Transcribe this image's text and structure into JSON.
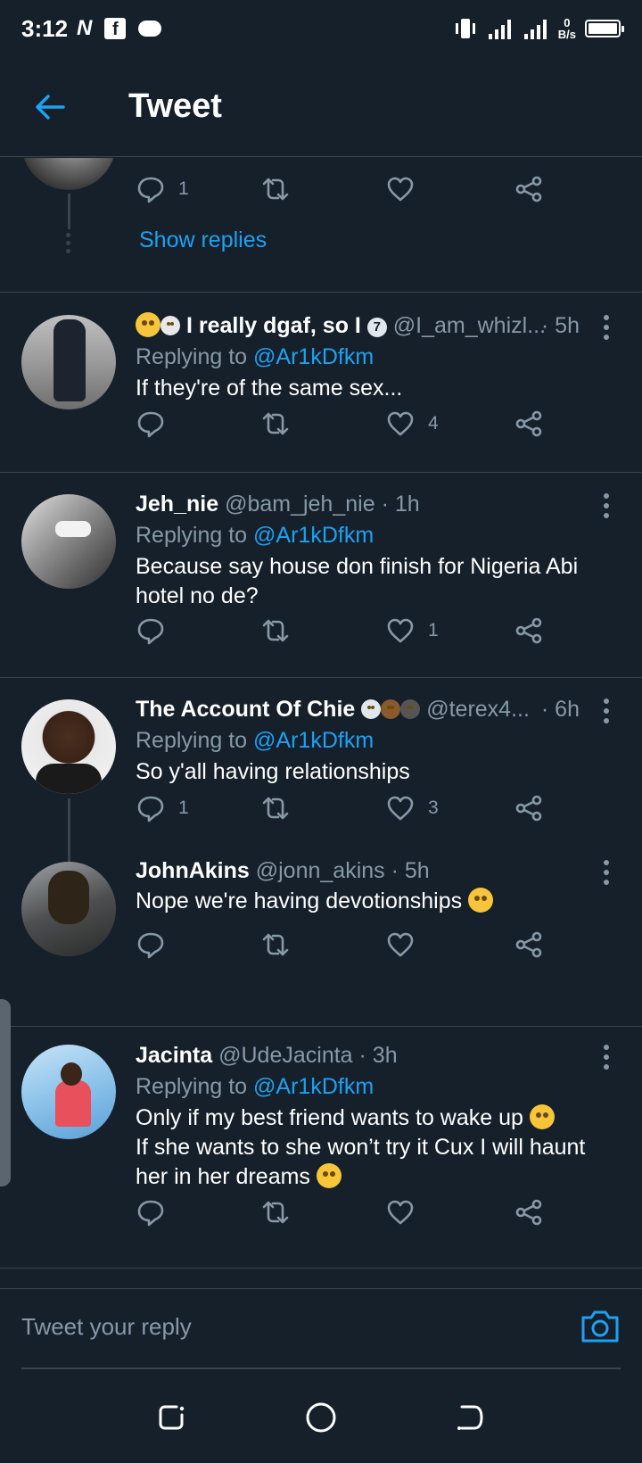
{
  "status_bar": {
    "time": "3:12",
    "left_icons": [
      "N",
      "f"
    ],
    "net_speed_value": "0",
    "net_speed_unit": "B/s"
  },
  "header": {
    "title": "Tweet"
  },
  "colors": {
    "background": "#15202b",
    "accent": "#1da1f2",
    "muted": "#8899a6",
    "divider": "#38444d"
  },
  "top_tweet": {
    "reply_count": "1",
    "show_replies": "Show replies"
  },
  "tweets": [
    {
      "name": "I really dgaf, so I",
      "handle": "@I_am_whizl...",
      "time": "· 5h",
      "replying_prefix": "Replying to ",
      "replying_to": "@Ar1kDfkm",
      "text": "If they're of the same sex...",
      "reply_count": "",
      "like_count": "4"
    },
    {
      "name": "Jeh_nie",
      "handle": "@bam_jeh_nie",
      "time": "· 1h",
      "replying_prefix": "Replying to ",
      "replying_to": "@Ar1kDfkm",
      "text": "Because say house don finish for Nigeria Abi hotel no de?",
      "reply_count": "",
      "like_count": "1"
    },
    {
      "name": "The Account Of Chie",
      "handle": "@terex4...",
      "time": "· 6h",
      "replying_prefix": "Replying to ",
      "replying_to": "@Ar1kDfkm",
      "text": "So y'all having relationships",
      "reply_count": "1",
      "like_count": "3"
    },
    {
      "name": "JohnAkins",
      "handle": "@jonn_akins",
      "time": "· 5h",
      "text": "Nope we're having devotionships",
      "reply_count": "",
      "like_count": ""
    },
    {
      "name": "Jacinta",
      "handle": "@UdeJacinta",
      "time": "· 3h",
      "replying_prefix": "Replying to ",
      "replying_to": "@Ar1kDfkm",
      "text_line1": "Only if my best friend wants to wake up",
      "text_line2": "If she wants to she won’t try it Cux I will haunt her in her dreams",
      "reply_count": "",
      "like_count": ""
    }
  ],
  "reply_bar": {
    "placeholder": "Tweet your reply"
  }
}
